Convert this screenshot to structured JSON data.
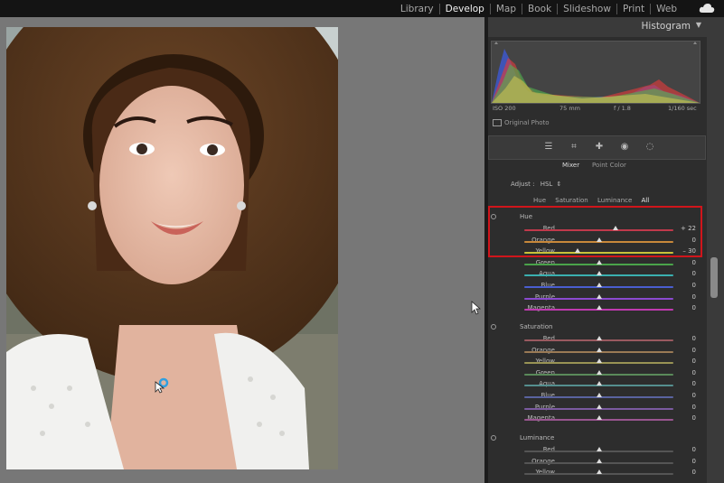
{
  "topbar": {
    "modules": [
      "Library",
      "Develop",
      "Map",
      "Book",
      "Slideshow",
      "Print",
      "Web"
    ],
    "active_module": "Develop"
  },
  "histogram": {
    "title": "Histogram",
    "iso": "ISO 200",
    "focal": "75 mm",
    "aperture": "f / 1.8",
    "shutter": "1/160 sec",
    "original_photo": "Original Photo"
  },
  "mixer": {
    "tabs": [
      "Mixer",
      "Point Color"
    ],
    "active_tab": "Mixer",
    "adjust_label": "Adjust :",
    "adjust_value": "HSL",
    "modes": [
      "Hue",
      "Saturation",
      "Luminance",
      "All"
    ],
    "active_mode": "All",
    "sections": [
      {
        "title": "Hue",
        "rows": [
          {
            "label": "Red",
            "value": "+ 22",
            "position": 0.61,
            "color": "#c0394b"
          },
          {
            "label": "Orange",
            "value": "0",
            "position": 0.5,
            "color": "#c8883a"
          },
          {
            "label": "Yellow",
            "value": "– 30",
            "position": 0.36,
            "color": "#c8c23a"
          },
          {
            "label": "Green",
            "value": "0",
            "position": 0.5,
            "color": "#4aa34a"
          },
          {
            "label": "Aqua",
            "value": "0",
            "position": 0.5,
            "color": "#3ab0b0"
          },
          {
            "label": "Blue",
            "value": "0",
            "position": 0.5,
            "color": "#4a5ed0"
          },
          {
            "label": "Purple",
            "value": "0",
            "position": 0.5,
            "color": "#8a4ad0"
          },
          {
            "label": "Magenta",
            "value": "0",
            "position": 0.5,
            "color": "#c03ab0"
          }
        ]
      },
      {
        "title": "Saturation",
        "rows": [
          {
            "label": "Red",
            "value": "0",
            "position": 0.5,
            "color": "#9a5a60"
          },
          {
            "label": "Orange",
            "value": "0",
            "position": 0.5,
            "color": "#9a7a55"
          },
          {
            "label": "Yellow",
            "value": "0",
            "position": 0.5,
            "color": "#999355"
          },
          {
            "label": "Green",
            "value": "0",
            "position": 0.5,
            "color": "#5a8a5a"
          },
          {
            "label": "Aqua",
            "value": "0",
            "position": 0.5,
            "color": "#558f8f"
          },
          {
            "label": "Blue",
            "value": "0",
            "position": 0.5,
            "color": "#5a63a0"
          },
          {
            "label": "Purple",
            "value": "0",
            "position": 0.5,
            "color": "#7b5aa0"
          },
          {
            "label": "Magenta",
            "value": "0",
            "position": 0.5,
            "color": "#9a5590"
          }
        ]
      },
      {
        "title": "Luminance",
        "rows": [
          {
            "label": "Red",
            "value": "0",
            "position": 0.5,
            "color": "#555"
          },
          {
            "label": "Orange",
            "value": "0",
            "position": 0.5,
            "color": "#555"
          },
          {
            "label": "Yellow",
            "value": "0",
            "position": 0.5,
            "color": "#555"
          }
        ]
      }
    ]
  },
  "colors": {
    "highlight": "#d0151b",
    "accent": "#2f9fe0"
  }
}
